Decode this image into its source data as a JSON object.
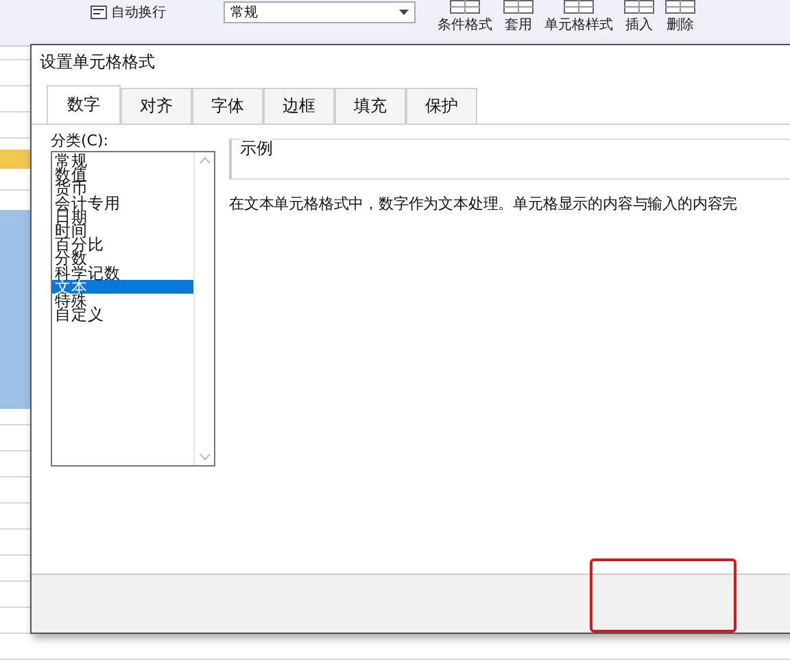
{
  "ribbon": {
    "wrap_button": "自动换行",
    "number_format": "常规",
    "commands": [
      {
        "label": "条件格式"
      },
      {
        "label": "套用"
      },
      {
        "label": "单元格样式"
      },
      {
        "label": "插入"
      },
      {
        "label": "删除"
      }
    ]
  },
  "dialog": {
    "title": "设置单元格格式",
    "tabs": [
      {
        "label": "数字",
        "selected": true
      },
      {
        "label": "对齐",
        "selected": false
      },
      {
        "label": "字体",
        "selected": false
      },
      {
        "label": "边框",
        "selected": false
      },
      {
        "label": "填充",
        "selected": false
      },
      {
        "label": "保护",
        "selected": false
      }
    ],
    "category_label": "分类(C):",
    "categories": [
      {
        "label": "常规",
        "selected": false
      },
      {
        "label": "数值",
        "selected": false
      },
      {
        "label": "货币",
        "selected": false
      },
      {
        "label": "会计专用",
        "selected": false
      },
      {
        "label": "日期",
        "selected": false
      },
      {
        "label": "时间",
        "selected": false
      },
      {
        "label": "百分比",
        "selected": false
      },
      {
        "label": "分数",
        "selected": false
      },
      {
        "label": "科学记数",
        "selected": false
      },
      {
        "label": "文本",
        "selected": true
      },
      {
        "label": "特殊",
        "selected": false
      },
      {
        "label": "自定义",
        "selected": false
      }
    ],
    "sample_label": "示例",
    "description": "在文本单元格格式中，数字作为文本处理。单元格显示的内容与输入的内容完"
  }
}
